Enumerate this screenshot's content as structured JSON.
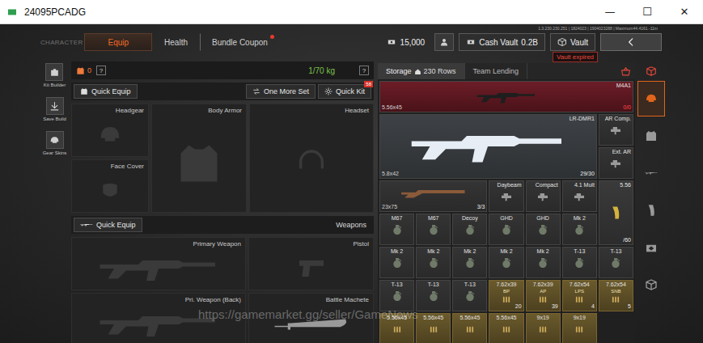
{
  "window": {
    "title": "24095PCADG",
    "controls": [
      "—",
      "☐",
      "✕"
    ]
  },
  "build_info": "1.3.230.230.251 | 1824023 | 1904023288 | Maximum44.4161.-11m",
  "section": "CHARACTER",
  "top_tabs": [
    {
      "label": "Equip",
      "selected": true,
      "badge": false
    },
    {
      "label": "Health",
      "selected": false,
      "badge": false
    },
    {
      "label": "Bundle Coupon",
      "selected": false,
      "badge": true
    }
  ],
  "currency": {
    "amount": "15,000"
  },
  "cash_vault": {
    "label": "Cash Vault",
    "amount": "0.2B"
  },
  "vault": {
    "label": "Vault",
    "badge": "Vault expired"
  },
  "sidebar": [
    {
      "label": "Kit Builder"
    },
    {
      "label": "Save Build"
    },
    {
      "label": "Gear Skins"
    }
  ],
  "loadout": {
    "armor_class": "0",
    "armor_help": "?",
    "weight": "1/70 kg",
    "weight_help": "?",
    "quick_equip": "Quick Equip",
    "one_more_set": "One More Set",
    "quick_kit": "Quick Kit",
    "quick_kit_badge": "58",
    "gear_slots": [
      {
        "label": "Headgear",
        "kind": "headgear",
        "equipped": false
      },
      {
        "label": "Body Armor",
        "kind": "armor",
        "equipped": false
      },
      {
        "label": "Headset",
        "kind": "headset",
        "equipped": false
      },
      {
        "label": "Face Cover",
        "kind": "face",
        "equipped": false
      }
    ],
    "weapons_bar": {
      "button": "Quick Equip",
      "title": "Weapons"
    },
    "weapon_slots": [
      {
        "label": "Primary Weapon",
        "kind": "primary",
        "equipped": false
      },
      {
        "label": "Pistol",
        "kind": "pistol",
        "equipped": false
      },
      {
        "label": "Pri. Weapon (Back)",
        "kind": "back",
        "equipped": false
      },
      {
        "label": "Battle Machete",
        "kind": "melee",
        "equipped": true
      }
    ]
  },
  "storage": {
    "tabs": [
      {
        "label": "Storage",
        "count": "230 Rows",
        "selected": true
      },
      {
        "label": "Team Lending",
        "selected": false
      }
    ],
    "items": [
      {
        "kind": "rifle-bar",
        "name": "M4A1",
        "caliber": "5.56x45",
        "count": "0/0"
      },
      {
        "kind": "rifle",
        "name": "LR-DMR1",
        "caliber": "5.8x42",
        "count": "29/30"
      },
      {
        "kind": "attachment",
        "name": "AR Comp."
      },
      {
        "kind": "attachment",
        "name": "Ext. AR"
      },
      {
        "kind": "shotgun",
        "caliber": "23x75",
        "count": "3/3"
      },
      {
        "kind": "attachment",
        "name": "Daybeam"
      },
      {
        "kind": "attachment",
        "name": "Compact"
      },
      {
        "kind": "attachment",
        "name": "4.1 Mult"
      },
      {
        "kind": "mag",
        "name": "5.56",
        "count": "/60"
      },
      {
        "kind": "grenade",
        "name": "M67"
      },
      {
        "kind": "grenade",
        "name": "M67"
      },
      {
        "kind": "grenade",
        "name": "Decoy"
      },
      {
        "kind": "grenade",
        "name": "GHD"
      },
      {
        "kind": "grenade",
        "name": "GHD"
      },
      {
        "kind": "grenade",
        "name": "Mk 2"
      },
      {
        "kind": "grenade",
        "name": "Mk 2"
      },
      {
        "kind": "grenade",
        "name": "Mk 2"
      },
      {
        "kind": "grenade",
        "name": "Mk 2"
      },
      {
        "kind": "grenade",
        "name": "Mk 2"
      },
      {
        "kind": "grenade",
        "name": "Mk 2"
      },
      {
        "kind": "grenade",
        "name": "T-13"
      },
      {
        "kind": "grenade",
        "name": "T-13"
      },
      {
        "kind": "grenade",
        "name": "T-13"
      },
      {
        "kind": "grenade",
        "name": "T-13"
      },
      {
        "kind": "grenade",
        "name": "T-13"
      },
      {
        "kind": "ammo",
        "name": "7.62x39",
        "sub": "BP",
        "count": "20"
      },
      {
        "kind": "ammo",
        "name": "7.62x39",
        "sub": "AP",
        "count": "39"
      },
      {
        "kind": "ammo",
        "name": "7.62x54",
        "sub": "LPS",
        "count": "4"
      },
      {
        "kind": "ammo",
        "name": "7.62x54",
        "sub": "SNB",
        "count": "5"
      },
      {
        "kind": "ammo",
        "name": "5.56x45"
      },
      {
        "kind": "ammo",
        "name": "5.56x45"
      },
      {
        "kind": "ammo",
        "name": "5.56x45"
      },
      {
        "kind": "ammo",
        "name": "5.56x45"
      },
      {
        "kind": "ammo",
        "name": "9x19"
      },
      {
        "kind": "ammo",
        "name": "9x19"
      }
    ]
  },
  "filters": [
    {
      "selected": true
    },
    {
      "selected": false
    },
    {
      "selected": false
    },
    {
      "selected": false
    },
    {
      "selected": false
    },
    {
      "selected": false
    }
  ],
  "watermark": "https://gamemarket.gg/seller/GameNews"
}
